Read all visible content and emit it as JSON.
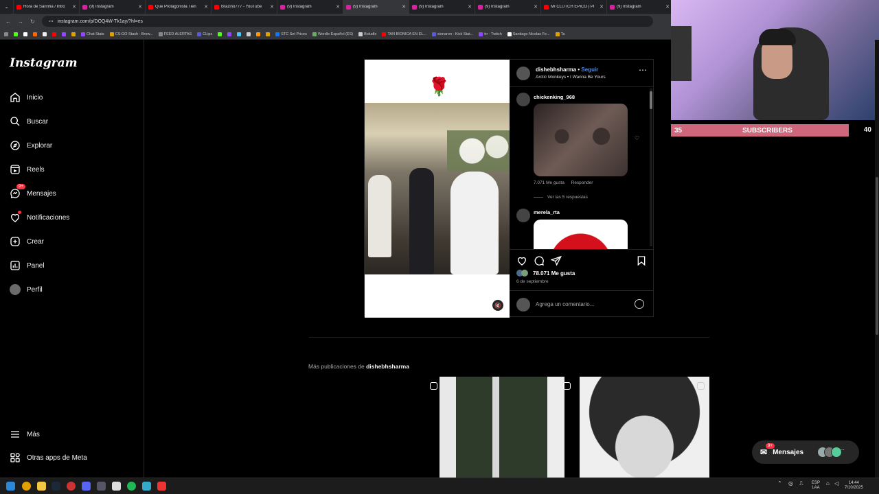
{
  "browser": {
    "tabs": [
      {
        "title": "Hora de Sarinha / Intro",
        "color": "#ff0000"
      },
      {
        "title": "(9) Instagram",
        "color": "#d6249f"
      },
      {
        "title": "Que Protagonista Tien",
        "color": "#ff0000"
      },
      {
        "title": "Brazino777 - YouTube",
        "color": "#ff0000"
      },
      {
        "title": "(9) Instagram",
        "color": "#d6249f"
      },
      {
        "title": "(9) Instagram",
        "color": "#d6249f"
      },
      {
        "title": "(9) Instagram",
        "color": "#d6249f"
      },
      {
        "title": "(9) Instagram",
        "color": "#d6249f"
      },
      {
        "title": "MI CLUTCH EPICO | PI",
        "color": "#ff0000"
      },
      {
        "title": "(9) Instagram",
        "color": "#d6249f"
      }
    ],
    "url": "instagram.com/p/DOQ4W-Tk1ay/?hl=es",
    "bookmarks": [
      "Chat Stats",
      "CS:GO Stash - Brow...",
      "FEED ALERTAS",
      "CLips",
      "STC Set Prices",
      "Wordle Español (ES)",
      "Boludle",
      "TAN BIONICA EN EL...",
      "sionaron - Kick Stat...",
      "trr - Twitch",
      "Santiago Nicolas Fe...",
      "Ta"
    ]
  },
  "sidebar": {
    "logo": "Instagram",
    "items": [
      {
        "label": "Inicio"
      },
      {
        "label": "Buscar"
      },
      {
        "label": "Explorar"
      },
      {
        "label": "Reels"
      },
      {
        "label": "Mensajes",
        "badge": "9+"
      },
      {
        "label": "Notificaciones"
      },
      {
        "label": "Crear"
      },
      {
        "label": "Panel"
      },
      {
        "label": "Perfil"
      }
    ],
    "more": "Más",
    "meta_apps": "Otras apps de Meta"
  },
  "post": {
    "username": "dishebhsharma",
    "follow": "Seguir",
    "separator": " • ",
    "song": "Arctic Monkeys • I Wanna Be Yours",
    "comments": [
      {
        "user": "chickenking_968",
        "likes": "7.071 Me gusta",
        "reply": "Responder",
        "replies": "Ver las 5 respuestas"
      },
      {
        "user": "merela_rta"
      }
    ],
    "likes": "78.071 Me gusta",
    "date": "6 de septiembre",
    "add_comment": "Agrega un comentario..."
  },
  "more_posts": {
    "prefix": "Más publicaciones de ",
    "user": "dishebhsharma"
  },
  "messages_pill": {
    "label": "Mensajes",
    "badge": "9+"
  },
  "stream_overlay": {
    "left": "35",
    "label": "SUBSCRIBERS",
    "right": "40",
    "bar_color": "#d0667c"
  },
  "taskbar": {
    "lang_top": "ESP",
    "lang_bottom": "LAA",
    "time": "14:44",
    "date": "7/10/2025"
  }
}
